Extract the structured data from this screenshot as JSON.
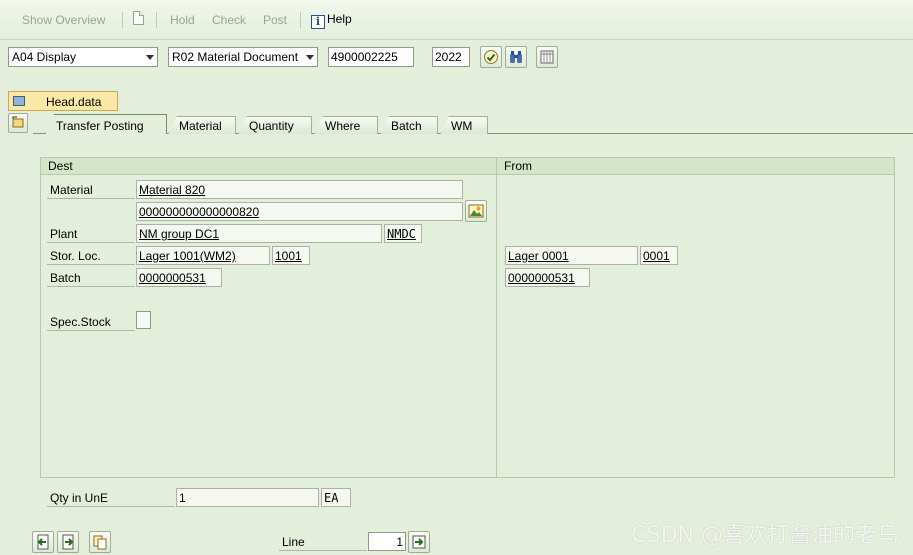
{
  "toolbar": {
    "show_overview": "Show Overview",
    "hold": "Hold",
    "check": "Check",
    "post": "Post",
    "help": "Help"
  },
  "selector": {
    "action": "A04 Display",
    "reference": "R02 Material Document",
    "document_number": "4900002225",
    "year": "2022"
  },
  "header": {
    "head_data_label": "Head.data"
  },
  "tabs": [
    {
      "label": "Transfer Posting",
      "active": true
    },
    {
      "label": "Material"
    },
    {
      "label": "Quantity"
    },
    {
      "label": "Where"
    },
    {
      "label": "Batch"
    },
    {
      "label": "WM"
    }
  ],
  "dest": {
    "section_label": "Dest",
    "material_label": "Material",
    "material_desc": "Material 820",
    "material_number": "000000000000000820",
    "plant_label": "Plant",
    "plant_desc": "NM group DC1",
    "plant_code": "NMDC",
    "storloc_label": "Stor. Loc.",
    "storloc_desc": "Lager 1001(WM2)",
    "storloc_code": "1001",
    "batch_label": "Batch",
    "batch_value": "0000000531",
    "specstock_label": "Spec.Stock"
  },
  "from": {
    "section_label": "From",
    "storloc_desc": "Lager 0001",
    "storloc_code": "0001",
    "batch_value": "0000000531"
  },
  "quantity": {
    "label": "Qty in UnE",
    "value": "1",
    "unit": "EA"
  },
  "footer": {
    "line_label": "Line",
    "line_value": "1"
  },
  "watermark": "CSDN @喜欢打酱油的老鸟"
}
